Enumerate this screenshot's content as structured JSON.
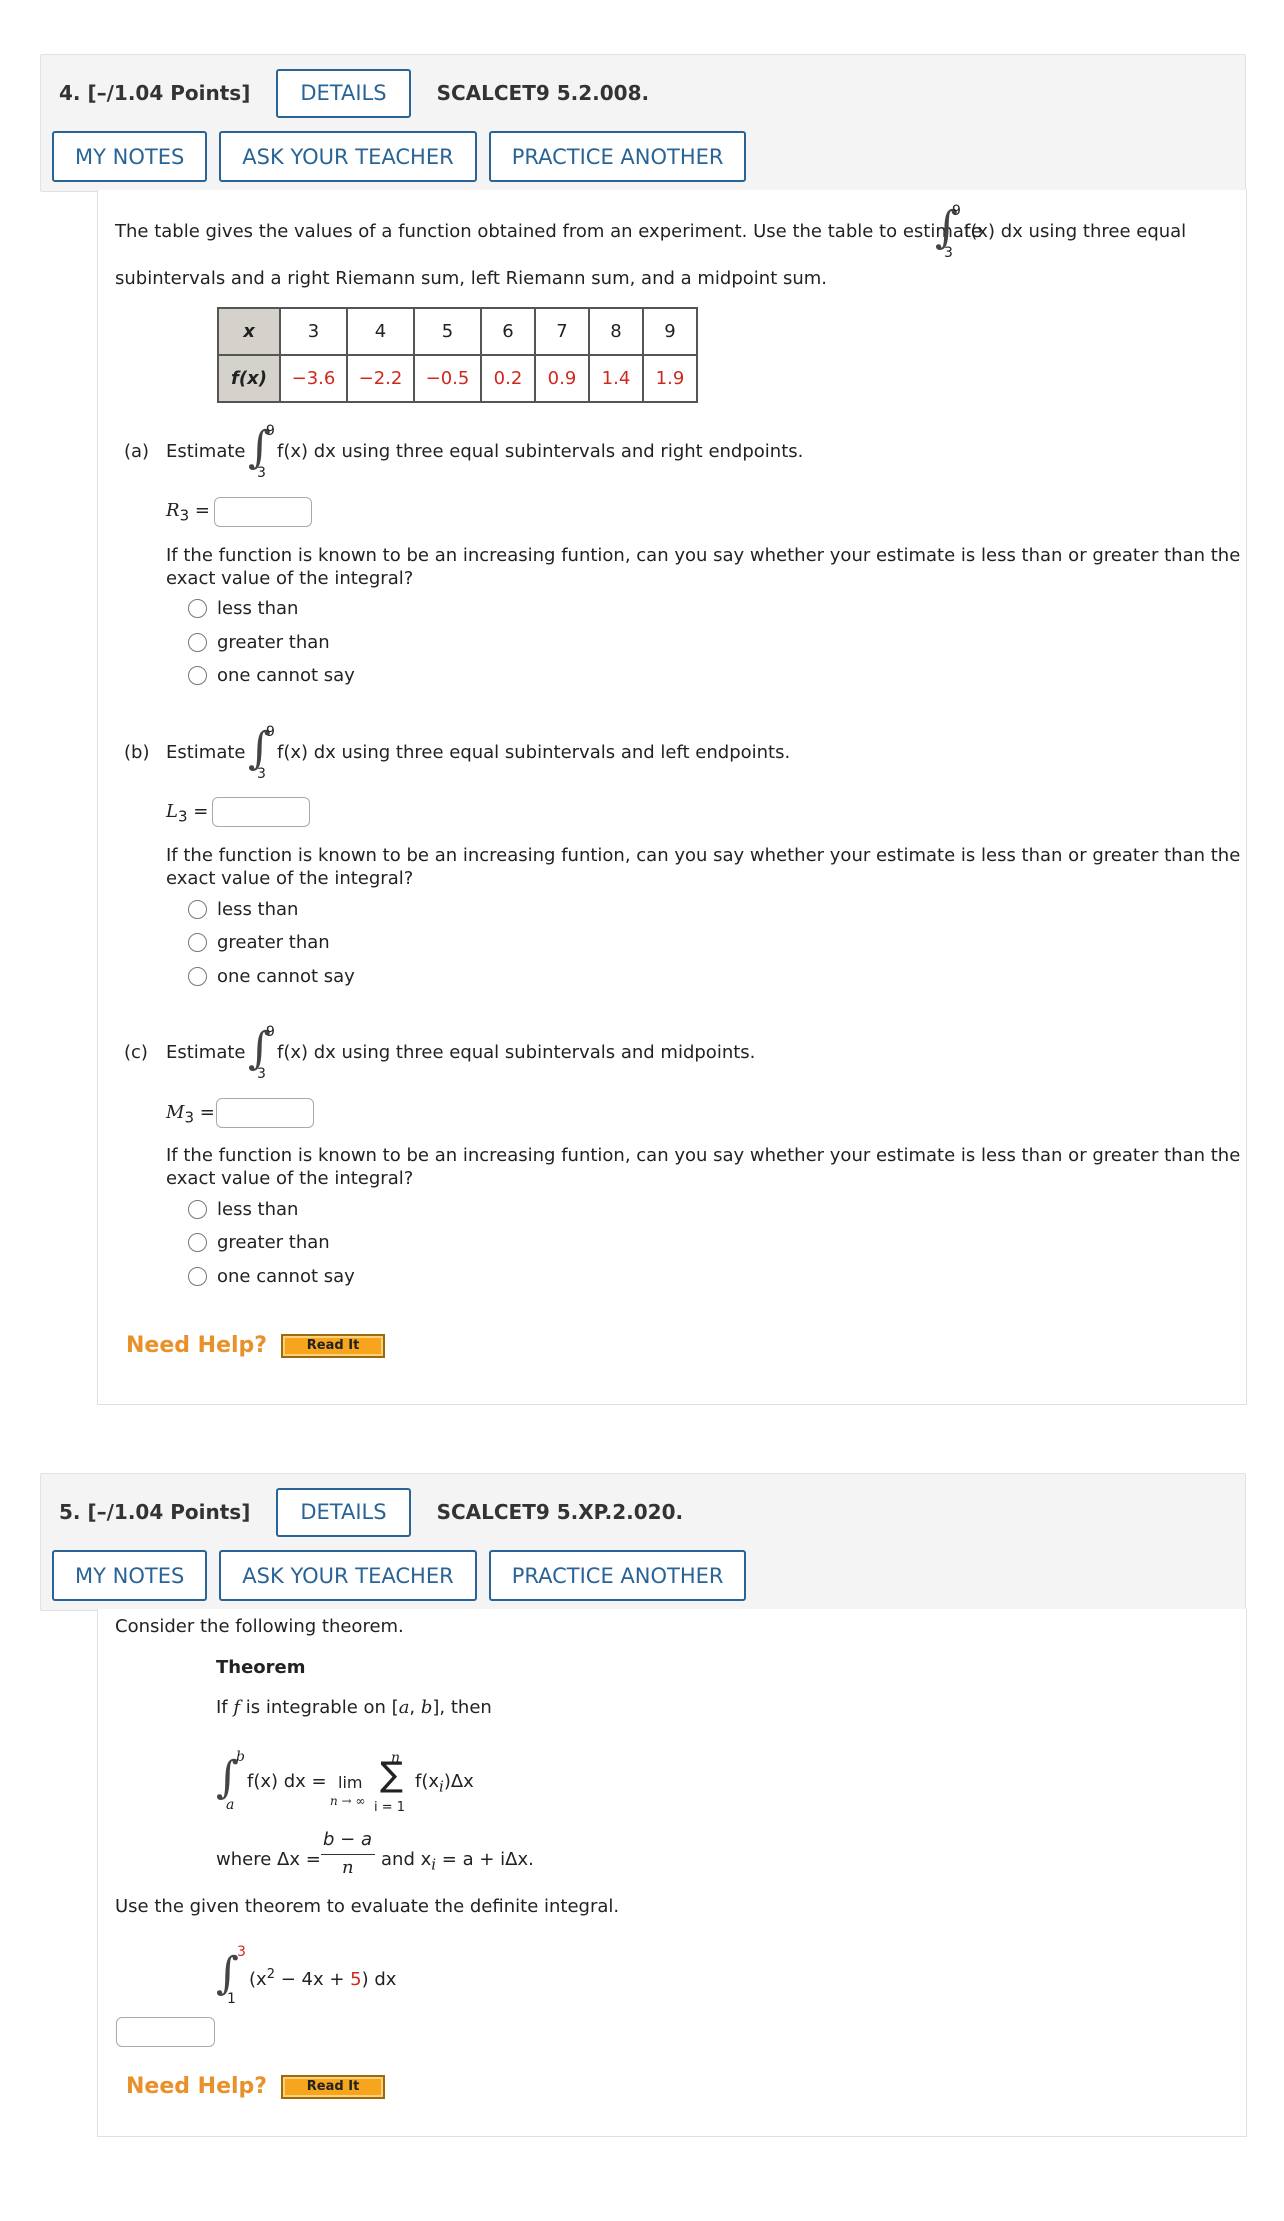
{
  "q4": {
    "title": "4.  [–/1.04 Points]",
    "details_label": "DETAILS",
    "code": "SCALCET9 5.2.008.",
    "my_notes_label": "MY NOTES",
    "ask_teacher_label": "ASK YOUR TEACHER",
    "practice_label": "PRACTICE ANOTHER",
    "intro_1": "The table gives the values of a function obtained from an experiment. Use the table to estimate",
    "intro_1_tail": "f(x) dx using three equal",
    "intro_2": "subintervals and a right Riemann sum, left Riemann sum, and a midpoint sum.",
    "int_lower": "3",
    "int_upper": "9",
    "table": {
      "x_label": "x",
      "fx_label": "f(x)",
      "x_values": [
        "3",
        "4",
        "5",
        "6",
        "7",
        "8",
        "9"
      ],
      "fx_values": [
        "−3.6",
        "−2.2",
        "−0.5",
        "0.2",
        "0.9",
        "1.4",
        "1.9"
      ]
    },
    "parts": [
      {
        "label": "(a)",
        "estimate": "Estimate",
        "tail": "f(x) dx using three equal subintervals and right endpoints.",
        "var": "R",
        "sub": "3",
        "eq": "=",
        "question_1": "If the function is known to be an increasing funtion, can you say whether your estimate is less than or greater than the",
        "question_2": "exact value of the integral?",
        "options": [
          "less than",
          "greater than",
          "one cannot say"
        ]
      },
      {
        "label": "(b)",
        "estimate": "Estimate",
        "tail": "f(x) dx using three equal subintervals and left endpoints.",
        "var": "L",
        "sub": "3",
        "eq": "=",
        "question_1": "If the function is known to be an increasing funtion, can you say whether your estimate is less than or greater than the",
        "question_2": "exact value of the integral?",
        "options": [
          "less than",
          "greater than",
          "one cannot say"
        ]
      },
      {
        "label": "(c)",
        "estimate": "Estimate",
        "tail": "f(x) dx using three equal subintervals and midpoints.",
        "var": "M",
        "sub": "3",
        "eq": "=",
        "question_1": "If the function is known to be an increasing funtion, can you say whether your estimate is less than or greater than the",
        "question_2": "exact value of the integral?",
        "options": [
          "less than",
          "greater than",
          "one cannot say"
        ]
      }
    ],
    "need_help": "Need Help?",
    "read_it": "Read It"
  },
  "q5": {
    "title": "5.  [–/1.04 Points]",
    "details_label": "DETAILS",
    "code": "SCALCET9 5.XP.2.020.",
    "my_notes_label": "MY NOTES",
    "ask_teacher_label": "ASK YOUR TEACHER",
    "practice_label": "PRACTICE ANOTHER",
    "intro": "Consider the following theorem.",
    "theorem_heading": "Theorem",
    "theorem_if": "If",
    "theorem_f": "f",
    "theorem_integrable": "is integrable on [",
    "theorem_a": "a",
    "theorem_comma": ", ",
    "theorem_b": "b",
    "theorem_then": "], then",
    "int_lower": "a",
    "int_upper": "b",
    "formula_lhs": "f(x) dx =",
    "lim_word": "lim",
    "lim_sub": "n → ∞",
    "sigma": "∑",
    "sum_top": "n",
    "sum_bottom": "i = 1",
    "sum_term": "f(x",
    "sum_term_sub": "i",
    "sum_term_tail": ")Δx",
    "where": "where Δx =",
    "frac_num": "b − a",
    "frac_den": "n",
    "and_text": "and x",
    "and_sub": "i",
    "and_tail": "= a + iΔx.",
    "instruction": "Use the given theorem to evaluate the definite integral.",
    "integral_lower": "1",
    "integral_upper": "3",
    "integrand_pre": "(x",
    "integrand_exp": "2",
    "integrand_mid": " − 4x + ",
    "integrand_const": "5",
    "integrand_post": ") dx",
    "need_help": "Need Help?",
    "read_it": "Read It"
  },
  "colors": {
    "accent": "#2a6496",
    "data_red": "#d0281e",
    "help_orange": "#e8912b",
    "header_bg": "#f4f4f4"
  }
}
